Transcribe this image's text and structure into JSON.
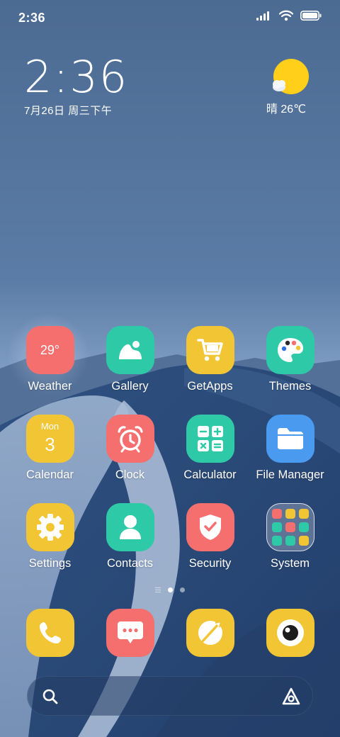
{
  "status_bar": {
    "time": "2:36",
    "icons": [
      "signal-icon",
      "wifi-icon",
      "battery-icon"
    ]
  },
  "clock_widget": {
    "time": "2:36",
    "date": "7月26日 周三下午"
  },
  "weather_widget": {
    "icon": "sun-cloud-icon",
    "text": "晴 26℃"
  },
  "apps": [
    {
      "label": "Weather",
      "icon": "weather-icon",
      "color": "#f56f6f",
      "badge_text": "29°"
    },
    {
      "label": "Gallery",
      "icon": "gallery-icon",
      "color": "#2ecaa8"
    },
    {
      "label": "GetApps",
      "icon": "shopping-cart-icon",
      "color": "#f2c534"
    },
    {
      "label": "Themes",
      "icon": "palette-icon",
      "color": "#2ecaa8"
    },
    {
      "label": "Calendar",
      "icon": "calendar-icon",
      "color": "#f2c534",
      "day_text": "Mon",
      "date_text": "3"
    },
    {
      "label": "Clock",
      "icon": "alarm-clock-icon",
      "color": "#f56f6f"
    },
    {
      "label": "Calculator",
      "icon": "calculator-icon",
      "color": "#2ecaa8"
    },
    {
      "label": "File Manager",
      "icon": "folder-icon",
      "color": "#4a9af0"
    },
    {
      "label": "Settings",
      "icon": "gear-icon",
      "color": "#f2c534"
    },
    {
      "label": "Contacts",
      "icon": "contact-person-icon",
      "color": "#2ecaa8"
    },
    {
      "label": "Security",
      "icon": "shield-check-icon",
      "color": "#f56f6f"
    },
    {
      "label": "System",
      "icon": "folder-grid-icon",
      "color": "#ffffff"
    }
  ],
  "system_folder_colors": [
    "#f56f6f",
    "#f2c534",
    "#f2c534",
    "#2ecaa8",
    "#f56f6f",
    "#2ecaa8",
    "#2ecaa8",
    "#2ecaa8",
    "#f2c534"
  ],
  "pager": {
    "pages": 2,
    "active": 0
  },
  "dock": [
    {
      "icon": "phone-icon",
      "color": "#f2c534"
    },
    {
      "icon": "message-icon",
      "color": "#f56f6f"
    },
    {
      "icon": "browser-compass-icon",
      "color": "#f2c534"
    },
    {
      "icon": "camera-icon",
      "color": "#f2c534"
    }
  ],
  "search": {
    "placeholder": "",
    "left_icon": "search-icon",
    "right_icon": "assistant-icon"
  },
  "colors": {
    "sky_top": "#4f6f97",
    "sky_bottom": "#7f9fc4",
    "dune_dark": "#2b4c7d",
    "dune_light": "#8ea8ca",
    "sun": "#ffcf1a"
  }
}
